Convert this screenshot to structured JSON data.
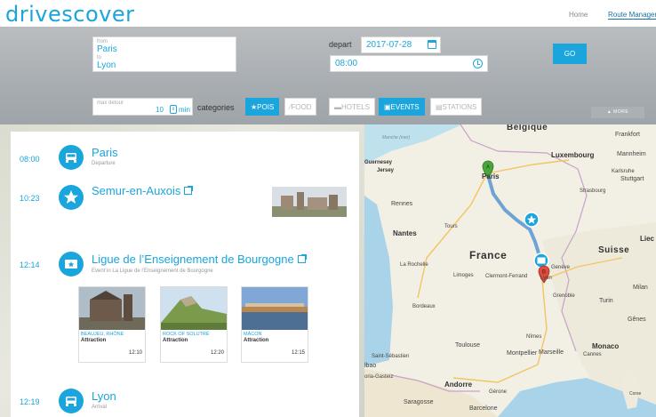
{
  "header": {
    "logo": "drivescover",
    "nav_home": "Home",
    "nav_route_manager": "Route Manager"
  },
  "search": {
    "from_label": "from",
    "from_value": "Paris",
    "to_label": "to",
    "to_value": "Lyon",
    "depart_label": "depart",
    "date_value": "2017-07-28",
    "time_value": "08:00",
    "go_label": "GO",
    "more_label": "▲ MORE",
    "max_detour_label": "max detour",
    "max_detour_value": "10",
    "max_detour_unit": "min",
    "categories_label": "categories",
    "categories": [
      {
        "label": "★POIS",
        "active": true
      },
      {
        "label": "⁄FOOD",
        "active": false
      },
      {
        "label": "▬HOTELS",
        "active": false
      },
      {
        "label": "▣EVENTS",
        "active": true
      },
      {
        "label": "▤STATIONS",
        "active": false
      }
    ]
  },
  "route": {
    "stops": [
      {
        "time": "08:00",
        "title": "Paris",
        "subtitle": "Departure",
        "icon": "car-icon"
      },
      {
        "time": "10:23",
        "title": "Semur-en-Auxois",
        "subtitle": "",
        "icon": "star-icon"
      },
      {
        "time": "12:14",
        "title": "Ligue de l’Enseignement de Bourgogne",
        "subtitle": "Event in La Ligue de l’Enseignement de Bourgogne",
        "icon": "ticket-icon"
      },
      {
        "time": "12:19",
        "title": "Lyon",
        "subtitle": "Arrival",
        "icon": "car-icon"
      }
    ],
    "pois": [
      {
        "name": "BEAUJEU, RHÔNE",
        "type": "Attraction",
        "time": "12:10"
      },
      {
        "name": "ROCK OF SOLUTRÉ",
        "type": "Attraction",
        "time": "12:20"
      },
      {
        "name": "MÂCON",
        "type": "Attraction",
        "time": "12:15"
      }
    ]
  },
  "map": {
    "labels": {
      "manche": "Manche (mer)",
      "guernesey": "Guernesey",
      "jersey": "Jersey",
      "belgique": "Belgique",
      "francfort": "Frankfort",
      "luxembourg": "Luxembourg",
      "mannheim": "Mannheim",
      "karlsruhe": "Karlsruhe",
      "stuttgart": "Stuttgart",
      "strasbourg": "Strasbourg",
      "paris": "Paris",
      "rennes": "Rennes",
      "nantes": "Nantes",
      "tours": "Tours",
      "france": "France",
      "suisse": "Suisse",
      "liege": "Liec",
      "larochelle": "La Rochelle",
      "limoges": "Limoges",
      "clermont": "Clermont-Ferrand",
      "lyon": "Lyon",
      "geneve": "Genève",
      "grenoble": "Grenoble",
      "milan": "Milan",
      "turin": "Turin",
      "bordeaux": "Bordeaux",
      "genes": "Gênes",
      "toulouse": "Toulouse",
      "nimes": "Nîmes",
      "montpellier": "Montpellier",
      "marseille": "Marseille",
      "monaco": "Monaco",
      "cannes": "Cannes",
      "saintseb": "Saint-Sébastien",
      "bilbao": "lbao",
      "vitoria": "oria-Gasteiz",
      "andorre": "Andorre",
      "girone": "Gérone",
      "saragosse": "Saragosse",
      "barcelone": "Barcelone",
      "corse": "Corse",
      "marker_a": "A",
      "marker_b": "B"
    }
  }
}
